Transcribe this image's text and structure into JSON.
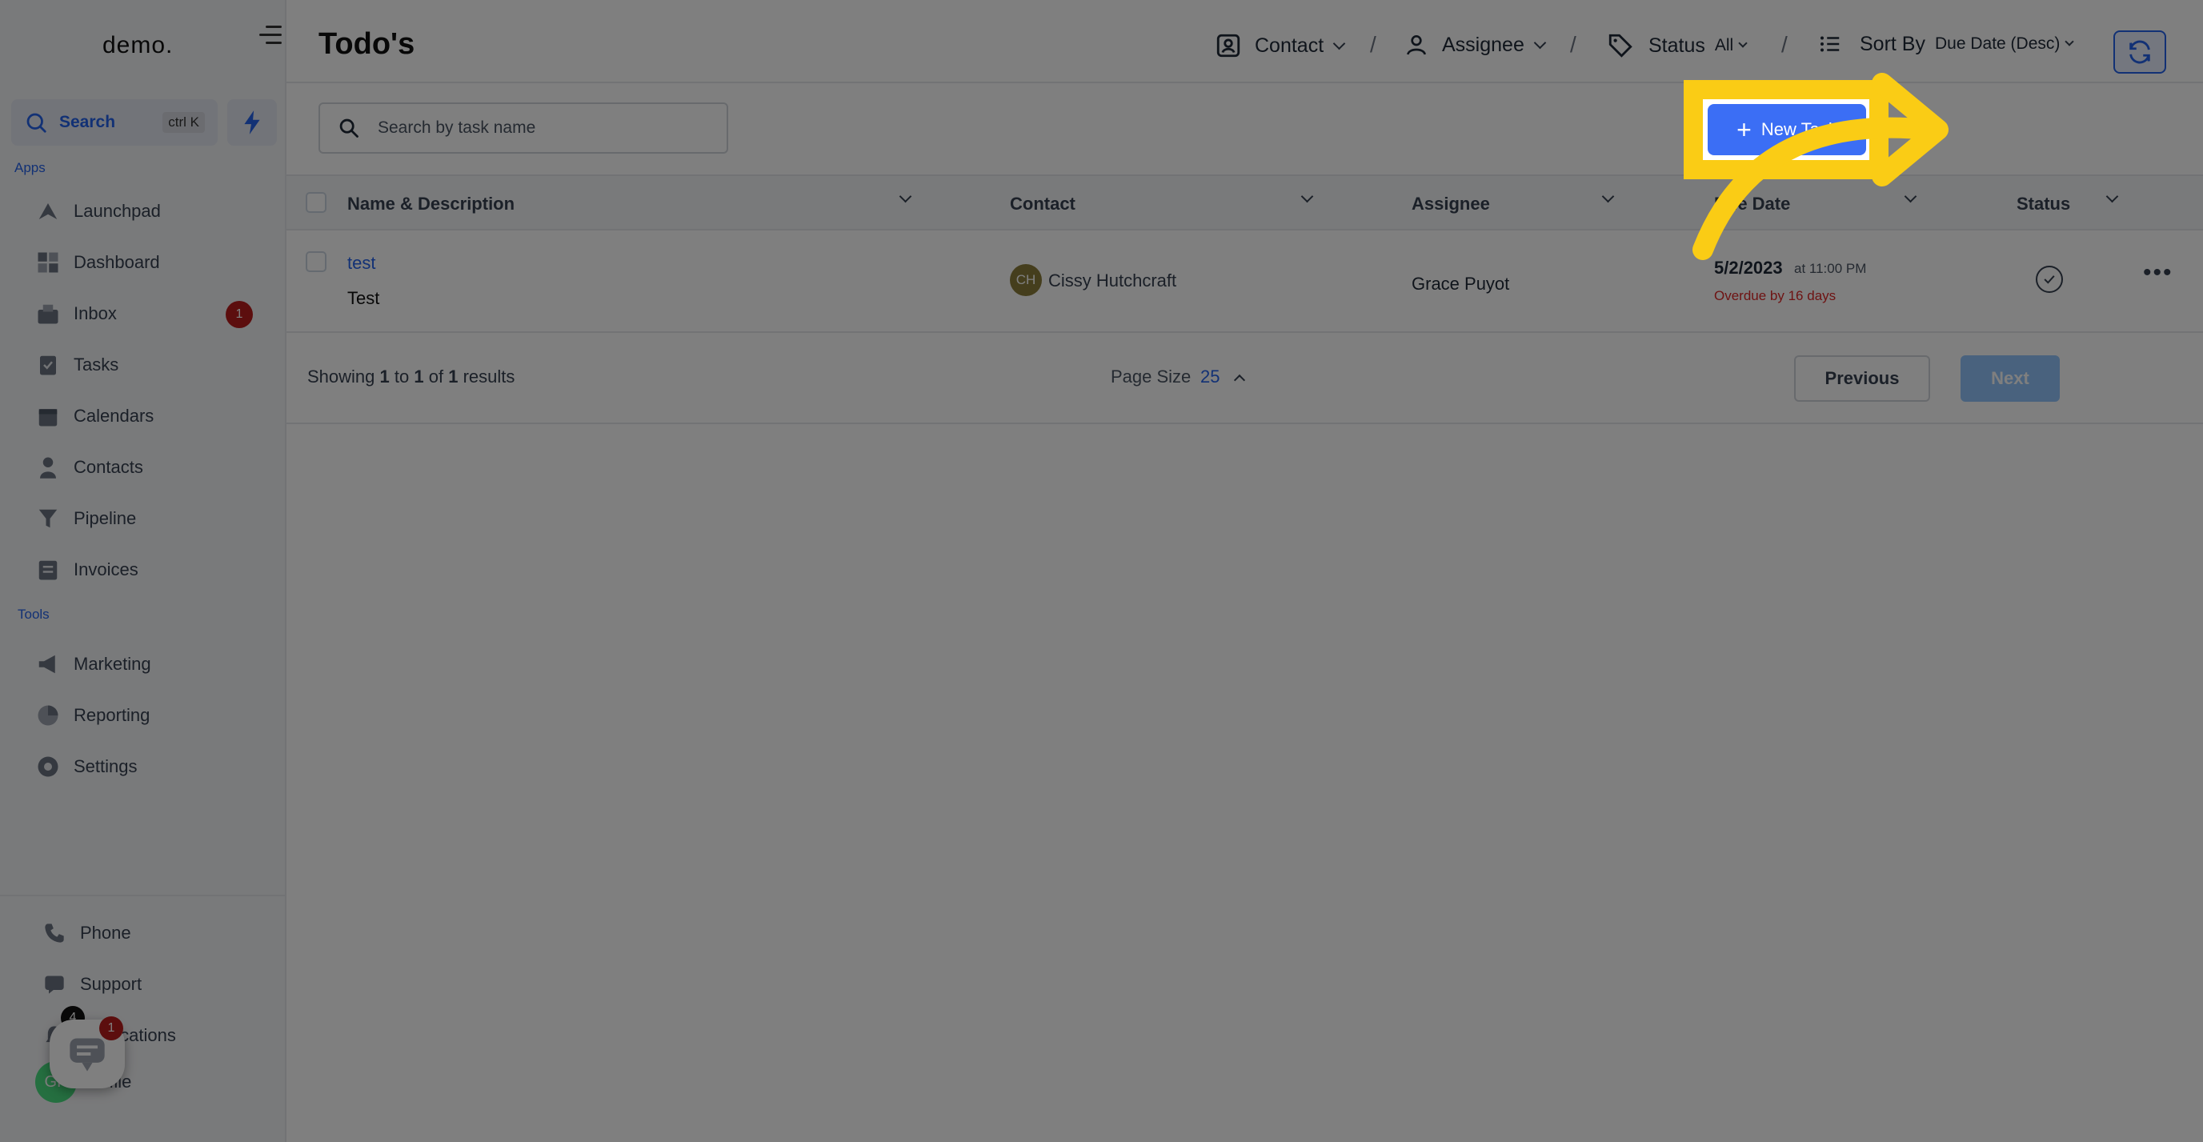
{
  "app": {
    "logo": "demo."
  },
  "sidebar": {
    "search_label": "Search",
    "search_shortcut": "ctrl K",
    "apps_label": "Apps",
    "tools_label": "Tools",
    "apps": [
      {
        "label": "Launchpad",
        "icon": "rocket-icon"
      },
      {
        "label": "Dashboard",
        "icon": "grid-icon"
      },
      {
        "label": "Inbox",
        "icon": "inbox-icon",
        "badge": "1"
      },
      {
        "label": "Tasks",
        "icon": "clipboard-icon"
      },
      {
        "label": "Calendars",
        "icon": "calendar-icon"
      },
      {
        "label": "Contacts",
        "icon": "person-icon"
      },
      {
        "label": "Pipeline",
        "icon": "filter-icon"
      },
      {
        "label": "Invoices",
        "icon": "invoice-icon"
      }
    ],
    "tools": [
      {
        "label": "Marketing",
        "icon": "megaphone-icon"
      },
      {
        "label": "Reporting",
        "icon": "pie-chart-icon"
      },
      {
        "label": "Settings",
        "icon": "gear-icon"
      }
    ],
    "bottom": {
      "phone": "Phone",
      "support": "Support",
      "notifications": "Notifications",
      "notifications_badge": "4",
      "profile": "Profile",
      "profile_initials": "GP",
      "chat_badge": "1"
    }
  },
  "header": {
    "title": "Todo's",
    "contact_filter": "Contact",
    "assignee_filter": "Assignee",
    "status_filter": "Status",
    "status_value": "All",
    "sort_label": "Sort By",
    "sort_value": "Due Date (Desc)",
    "separator": "/"
  },
  "search": {
    "placeholder": "Search by task name"
  },
  "new_task": {
    "label": "New Task"
  },
  "table": {
    "columns": [
      "Name & Description",
      "Contact",
      "Assignee",
      "Due Date",
      "Status"
    ],
    "rows": [
      {
        "name": "test",
        "description": "Test",
        "contact_initials": "CH",
        "contact": "Cissy Hutchcraft",
        "assignee": "Grace Puyot",
        "due_date": "5/2/2023",
        "due_time": "at 11:00 PM",
        "overdue": "Overdue by 16 days"
      }
    ]
  },
  "footer": {
    "showing_prefix": "Showing",
    "from": "1",
    "to_word": "to",
    "to": "1",
    "of_word": "of",
    "total": "1",
    "results_word": "results",
    "page_size_label": "Page Size",
    "page_size": "25",
    "previous": "Previous",
    "next": "Next"
  },
  "colors": {
    "accent": "#3b6ef5",
    "highlight": "#facc15",
    "overdue": "#dc2626",
    "badge": "#b91c1c"
  }
}
